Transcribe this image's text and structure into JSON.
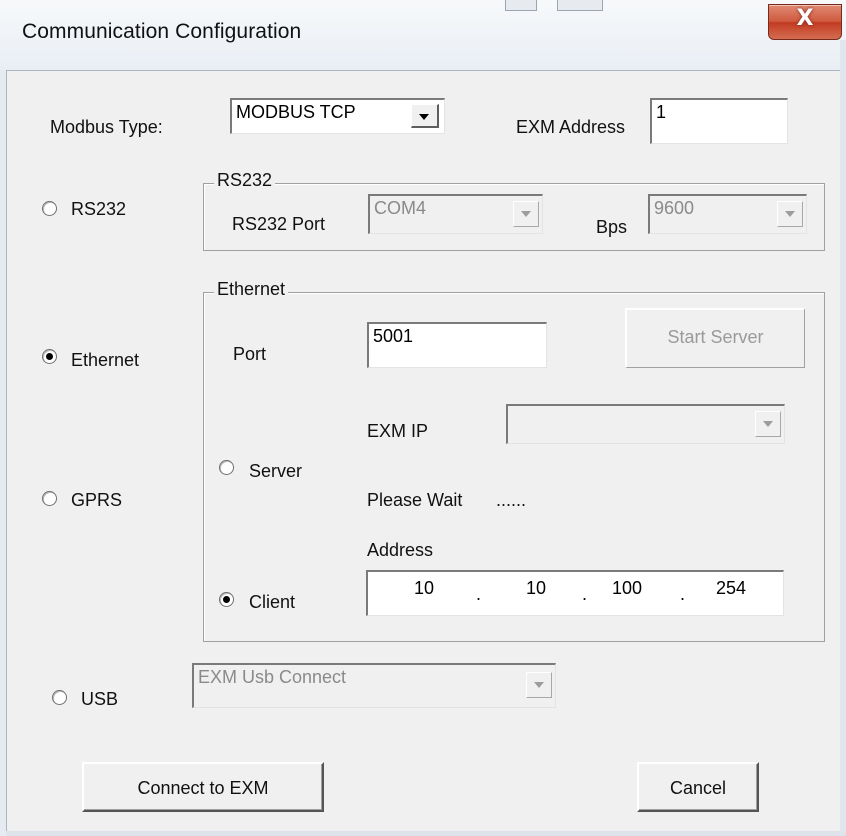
{
  "window": {
    "title": "Communication Configuration",
    "close_glyph": "X"
  },
  "modbus": {
    "label": "Modbus Type:",
    "value": "MODBUS TCP",
    "exm_address_label": "EXM Address",
    "exm_address_value": "1"
  },
  "rs232": {
    "radio_label": "RS232",
    "group_title": "RS232",
    "port_label": "RS232 Port",
    "port_value": "COM4",
    "bps_label": "Bps",
    "bps_value": "9600"
  },
  "ethernet": {
    "radio_label": "Ethernet",
    "group_title": "Ethernet",
    "port_label": "Port",
    "port_value": "5001",
    "start_server_label": "Start Server",
    "exm_ip_label": "EXM IP",
    "exm_ip_value": "",
    "server_label": "Server",
    "please_wait": "Please Wait",
    "wait_dots": "......",
    "address_label": "Address",
    "client_label": "Client",
    "ip": [
      "10",
      "10",
      "100",
      "254"
    ]
  },
  "gprs": {
    "radio_label": "GPRS"
  },
  "usb": {
    "radio_label": "USB",
    "device_value": "EXM Usb Connect"
  },
  "buttons": {
    "connect": "Connect to EXM",
    "cancel": "Cancel"
  },
  "state": {
    "selected_interface": "Ethernet",
    "ethernet_mode": "Client"
  }
}
